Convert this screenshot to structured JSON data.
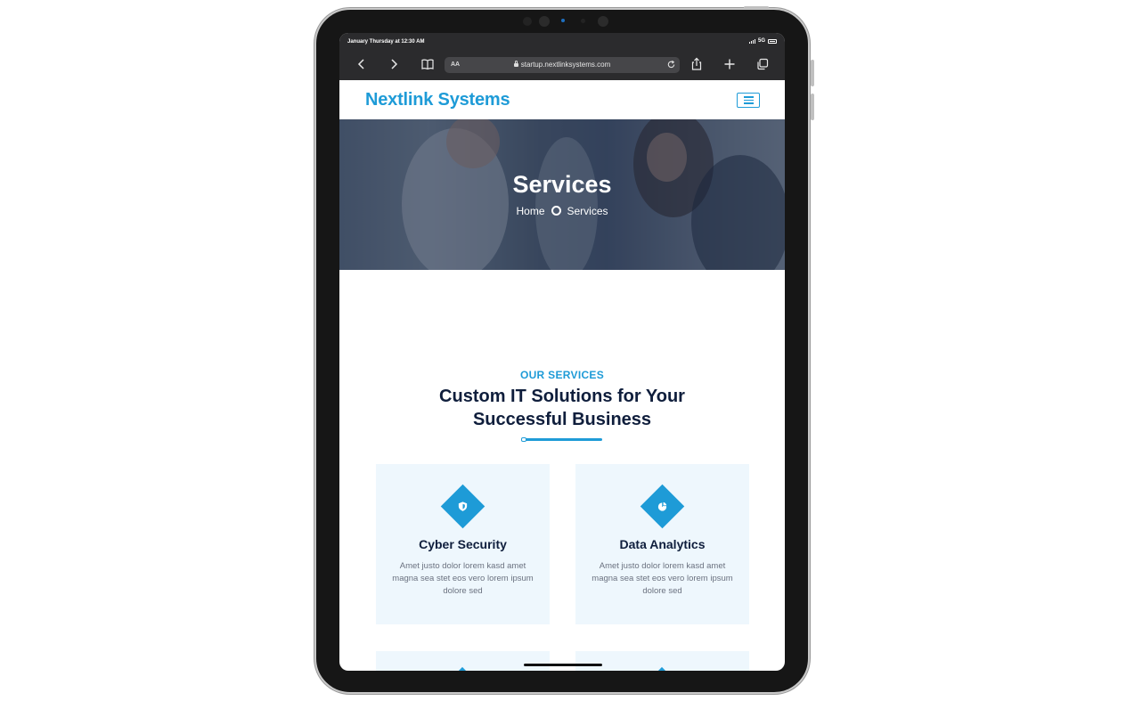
{
  "statusbar": {
    "time": "January Thursday at 12:30 AM",
    "network": "5G"
  },
  "browser": {
    "text_size_label": "AA",
    "url": "startup.nextlinksystems.com"
  },
  "site": {
    "brand": "Nextlink Systems"
  },
  "hero": {
    "title": "Services",
    "breadcrumb_home": "Home",
    "breadcrumb_current": "Services"
  },
  "section": {
    "tag": "OUR SERVICES",
    "title": "Custom IT Solutions for Your Successful Business"
  },
  "cards": [
    {
      "title": "Cyber Security",
      "icon": "shield-icon",
      "text": "Amet justo dolor lorem kasd amet magna sea stet eos vero lorem ipsum dolore sed"
    },
    {
      "title": "Data Analytics",
      "icon": "pie-chart-icon",
      "text": "Amet justo dolor lorem kasd amet magna sea stet eos vero lorem ipsum dolore sed"
    }
  ],
  "colors": {
    "accent": "#1e9bd7",
    "heading": "#0f1e3c",
    "card_bg": "#eef7fd",
    "device": "#161616",
    "toolbar": "#2b2b2d"
  }
}
